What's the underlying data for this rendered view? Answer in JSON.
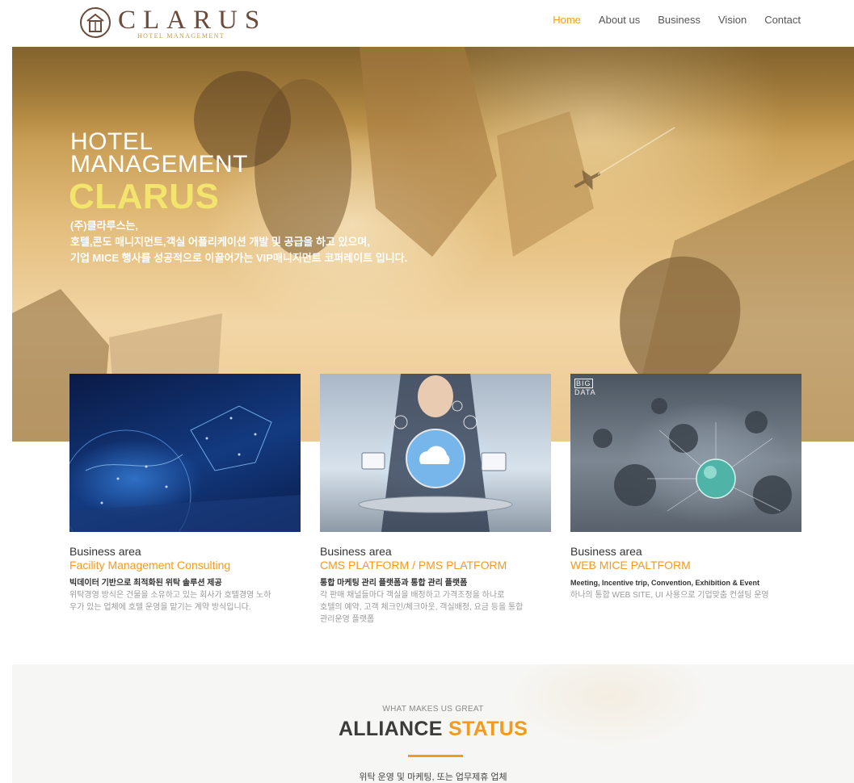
{
  "brand": {
    "name": "CLARUS",
    "tagline": "HOTEL MANAGEMENT",
    "colors": {
      "accent": "#f39a1e",
      "logo": "#6b4a3a",
      "logo_sub": "#c19a4a",
      "hero_highlight": "#f2e46c"
    }
  },
  "nav": {
    "items": [
      {
        "label": "Home",
        "active": true
      },
      {
        "label": "About us",
        "active": false
      },
      {
        "label": "Business",
        "active": false
      },
      {
        "label": "Vision",
        "active": false
      },
      {
        "label": "Contact",
        "active": false
      }
    ]
  },
  "hero": {
    "title_lines": [
      "HOTEL",
      "MANAGEMENT"
    ],
    "brand": "CLARUS",
    "copy_lines": [
      "(주)클라루스는,",
      "호텔,콘도 매니지먼트,객실 어플리케이션 개발 및 공급을 하고 있으며,",
      "기업 MICE 행사를 성공적으로 이끌어가는 VIP매니지먼트 코퍼레이트 입니다."
    ],
    "image_icon": "handshake-photo-icon"
  },
  "cards": [
    {
      "kicker": "Business area",
      "title": "Facility Management Consulting",
      "lead": "빅데이터 기반으로 최적화된 위탁 솔루션 제공",
      "desc_lines": [
        "위탁경영 방식은 건물을 소유하고 있는 회사가 호텔경영 노하",
        "우가 있는 업체에 호텔 운영을 맡기는 계약 방식입니다."
      ],
      "image_icon": "digital-earth-icon"
    },
    {
      "kicker": "Business area",
      "title": "CMS PLATFORM / PMS PLATFORM",
      "lead": "통합 마케팅 관리 플랫폼과 통합 관리 플랫폼",
      "desc_lines": [
        "각 판매 채널들마다 객실을 배정하고 가격조정을 하나로",
        "호텔의 예약, 고객 체크인/체크아웃, 객실배정, 요금 등을 통합",
        "관리운영 플랫폼"
      ],
      "image_icon": "cloud-tablet-icon"
    },
    {
      "kicker": "Business area",
      "title": "WEB MICE PALTFORM",
      "lead": "Meeting, Incentive trip, Convention, Exhibition & Event",
      "desc_lines": [
        "하나의 통합 WEB SITE, UI 사용으로 기업맞춤 컨설팅 운영"
      ],
      "image_icon": "big-data-globe-icon",
      "image_text": [
        "BIG",
        "DATA"
      ]
    }
  ],
  "alliance": {
    "eyebrow": "WHAT MAKES US GREAT",
    "title_main": "ALLIANCE",
    "title_accent": "STATUS",
    "subtitle": "위탁 운영 및 마케팅, 또는 업무제휴 업체"
  }
}
